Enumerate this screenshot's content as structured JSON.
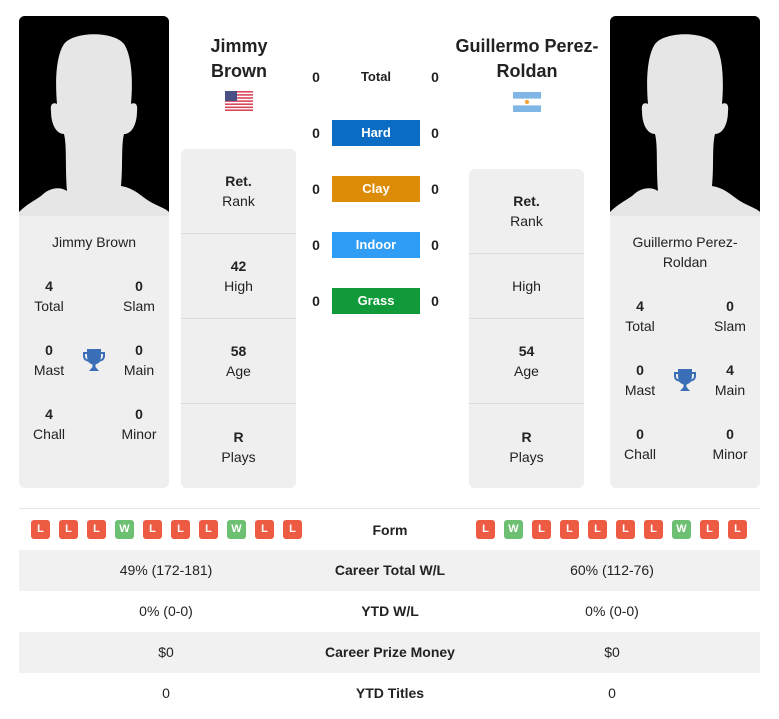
{
  "player1": {
    "name": "Jimmy Brown",
    "name_line1": "Jimmy",
    "name_line2": "Brown",
    "card_name": "Jimmy Brown",
    "country_flag": "usa-flag-icon",
    "titles": {
      "total": {
        "value": "4",
        "label": "Total"
      },
      "slam": {
        "value": "0",
        "label": "Slam"
      },
      "mast": {
        "value": "0",
        "label": "Mast"
      },
      "main": {
        "value": "0",
        "label": "Main"
      },
      "chall": {
        "value": "4",
        "label": "Chall"
      },
      "minor": {
        "value": "0",
        "label": "Minor"
      }
    },
    "info": {
      "rank": {
        "value": "Ret.",
        "label": "Rank"
      },
      "high": {
        "value": "42",
        "label": "High"
      },
      "age": {
        "value": "58",
        "label": "Age"
      },
      "plays": {
        "value": "R",
        "label": "Plays"
      }
    },
    "form": [
      "L",
      "L",
      "L",
      "W",
      "L",
      "L",
      "L",
      "W",
      "L",
      "L"
    ]
  },
  "player2": {
    "name": "Guillermo Perez-Roldan",
    "name_line1": "Guillermo Perez-",
    "name_line2": "Roldan",
    "card_name_line1": "Guillermo Perez-",
    "card_name_line2": "Roldan",
    "country_flag": "argentina-flag-icon",
    "titles": {
      "total": {
        "value": "4",
        "label": "Total"
      },
      "slam": {
        "value": "0",
        "label": "Slam"
      },
      "mast": {
        "value": "0",
        "label": "Mast"
      },
      "main": {
        "value": "4",
        "label": "Main"
      },
      "chall": {
        "value": "0",
        "label": "Chall"
      },
      "minor": {
        "value": "0",
        "label": "Minor"
      }
    },
    "info": {
      "rank": {
        "value": "Ret.",
        "label": "Rank"
      },
      "high": {
        "value": "",
        "label": "High"
      },
      "age": {
        "value": "54",
        "label": "Age"
      },
      "plays": {
        "value": "R",
        "label": "Plays"
      }
    },
    "form": [
      "L",
      "W",
      "L",
      "L",
      "L",
      "L",
      "L",
      "W",
      "L",
      "L"
    ]
  },
  "surfaces": [
    {
      "label": "Total",
      "left": "0",
      "right": "0",
      "color": ""
    },
    {
      "label": "Hard",
      "left": "0",
      "right": "0",
      "color": "#0b6cc4"
    },
    {
      "label": "Clay",
      "left": "0",
      "right": "0",
      "color": "#dd8c07"
    },
    {
      "label": "Indoor",
      "left": "0",
      "right": "0",
      "color": "#2f9cf5"
    },
    {
      "label": "Grass",
      "left": "0",
      "right": "0",
      "color": "#109a3a"
    }
  ],
  "form_label": "Form",
  "stats": [
    {
      "label": "Career Total W/L",
      "left": "49% (172-181)",
      "right": "60% (112-76)"
    },
    {
      "label": "YTD W/L",
      "left": "0% (0-0)",
      "right": "0% (0-0)"
    },
    {
      "label": "Career Prize Money",
      "left": "$0",
      "right": "$0"
    },
    {
      "label": "YTD Titles",
      "left": "0",
      "right": "0"
    }
  ],
  "colors": {
    "loss": "#ed5b43",
    "win": "#6dbf72",
    "trophy": "#3a6fb8"
  }
}
